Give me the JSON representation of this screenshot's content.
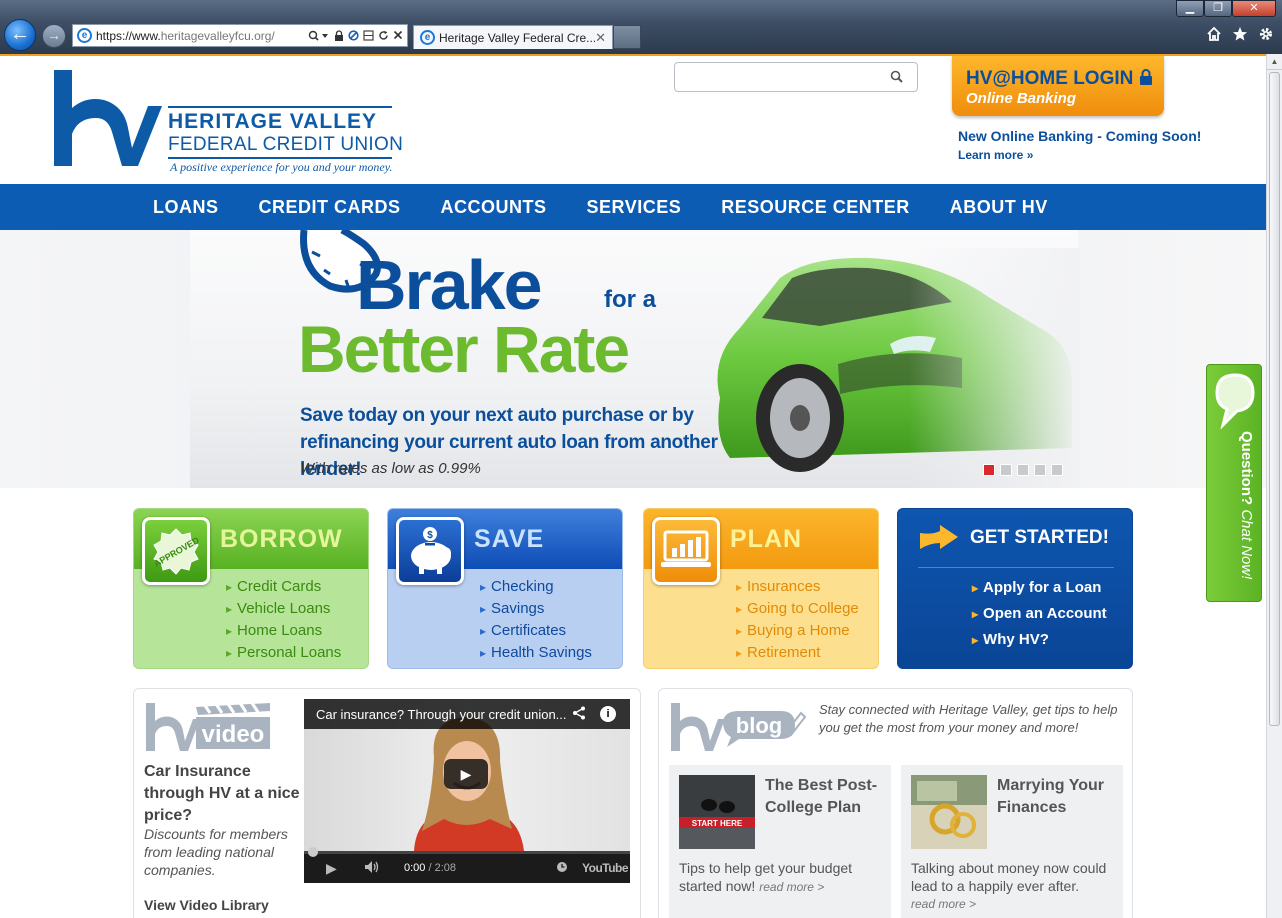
{
  "browser": {
    "url_host": "https://www.",
    "url_domain": "heritagevalleyfcu.org/",
    "tab_title": "Heritage Valley Federal Cre...",
    "tab_close": "✕",
    "back": "←",
    "forward": "→",
    "window_buttons": [
      "▁",
      "❐",
      "✕"
    ],
    "toolbar_icons": [
      "home-icon",
      "star-icon",
      "gear-icon"
    ]
  },
  "header": {
    "logo_line1": "HERITAGE VALLEY",
    "logo_line2": "FEDERAL CREDIT UNION",
    "logo_tagline": "A positive experience for you and your money.",
    "search_placeholder": "",
    "login_title": "HV@HOME LOGIN",
    "login_subtitle": "Online Banking",
    "promo_title": "New Online Banking - Coming Soon!",
    "promo_link": "Learn more »"
  },
  "nav": {
    "items": [
      "LOANS",
      "CREDIT CARDS",
      "ACCOUNTS",
      "SERVICES",
      "RESOURCE CENTER",
      "ABOUT HV"
    ]
  },
  "hero": {
    "headline_1": "Brake",
    "headline_1b": "for a",
    "headline_2": "Better Rate",
    "body_line1": "Save today on your next auto purchase or by",
    "body_line2": "refinancing your current auto loan from another lender!",
    "rate_note": "With rates as low as 0.99%",
    "slide_count": 5,
    "active_slide": 1
  },
  "cards": {
    "borrow": {
      "title": "BORROW",
      "badge": "APPROVED",
      "items": [
        "Credit Cards",
        "Vehicle Loans",
        "Home Loans",
        "Personal Loans"
      ]
    },
    "save": {
      "title": "SAVE",
      "items": [
        "Checking",
        "Savings",
        "Certificates",
        "Health Savings"
      ]
    },
    "plan": {
      "title": "PLAN",
      "items": [
        "Insurances",
        "Going to College",
        "Buying a Home",
        "Retirement"
      ]
    },
    "start": {
      "title": "GET STARTED!",
      "items": [
        "Apply for a Loan",
        "Open an Account",
        "Why HV?"
      ]
    }
  },
  "video": {
    "logo_word": "video",
    "heading": "Car Insurance through HV at a nice price?",
    "subtext": "Discounts for members from leading national companies.",
    "library_link": "View Video Library",
    "player_title": "Car insurance? Through your credit union...",
    "time_current": "0:00",
    "time_total": "/ 2:08",
    "watermark": "YouTube"
  },
  "blog": {
    "logo_word": "blog",
    "intro": "Stay connected with Heritage Valley, get tips to help you get the most from your money and more!",
    "posts": [
      {
        "title": "The Best Post-College Plan",
        "body": "Tips to help get your budget started now!",
        "more": "read more >",
        "thumb_text": "START HERE"
      },
      {
        "title": "Marrying Your Finances",
        "body": "Talking about money now could lead to a happily ever after.",
        "more": "read more >"
      }
    ]
  },
  "chat": {
    "question": "Question?",
    "action": "Chat Now!"
  },
  "colors": {
    "brand_blue": "#0d5cb3",
    "brand_orange": "#f39a10",
    "brand_green": "#6cbb2f"
  }
}
